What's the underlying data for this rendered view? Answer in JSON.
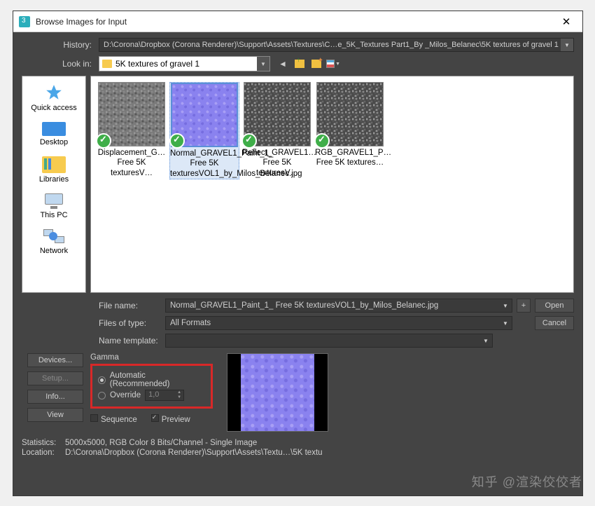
{
  "window": {
    "title": "Browse Images for Input"
  },
  "history": {
    "label": "History:",
    "value": "D:\\Corona\\Dropbox (Corona Renderer)\\Support\\Assets\\Textures\\C…e_5K_Textures Part1_By _Milos_Belanec\\5K textures of gravel 1"
  },
  "lookin": {
    "label": "Look in:",
    "value": "5K textures of gravel 1"
  },
  "places": {
    "quick_access": "Quick access",
    "desktop": "Desktop",
    "libraries": "Libraries",
    "this_pc": "This PC",
    "network": "Network"
  },
  "files": [
    {
      "name": "Displacement_G… Free 5K texturesV…"
    },
    {
      "name": "Normal_GRAVEL1_Paint_1_ Free 5K texturesVOL1_by_Milos_Belanec.jpg",
      "selected": true
    },
    {
      "name": "Reflect_GRAVEL1… Free 5K texturesV…"
    },
    {
      "name": "RGB_GRAVEL1_P… Free 5K textures…"
    }
  ],
  "form": {
    "filename_label": "File name:",
    "filename_value": "Normal_GRAVEL1_Paint_1_ Free 5K texturesVOL1_by_Milos_Belanec.jpg",
    "filetype_label": "Files of type:",
    "filetype_value": "All Formats",
    "nametpl_label": "Name template:",
    "nametpl_value": "",
    "open": "Open",
    "cancel": "Cancel",
    "plus": "+"
  },
  "buttons": {
    "devices": "Devices...",
    "setup": "Setup...",
    "info": "Info...",
    "view": "View"
  },
  "gamma": {
    "title": "Gamma",
    "automatic": "Automatic (Recommended)",
    "override": "Override",
    "override_value": "1,0"
  },
  "checks": {
    "sequence": "Sequence",
    "preview": "Preview"
  },
  "stats": {
    "stats_label": "Statistics:",
    "stats_value": "5000x5000, RGB Color 8 Bits/Channel - Single Image",
    "loc_label": "Location:",
    "loc_value": "D:\\Corona\\Dropbox (Corona Renderer)\\Support\\Assets\\Textu…\\5K textu"
  },
  "watermark": "知乎 @渲染佼佼者"
}
